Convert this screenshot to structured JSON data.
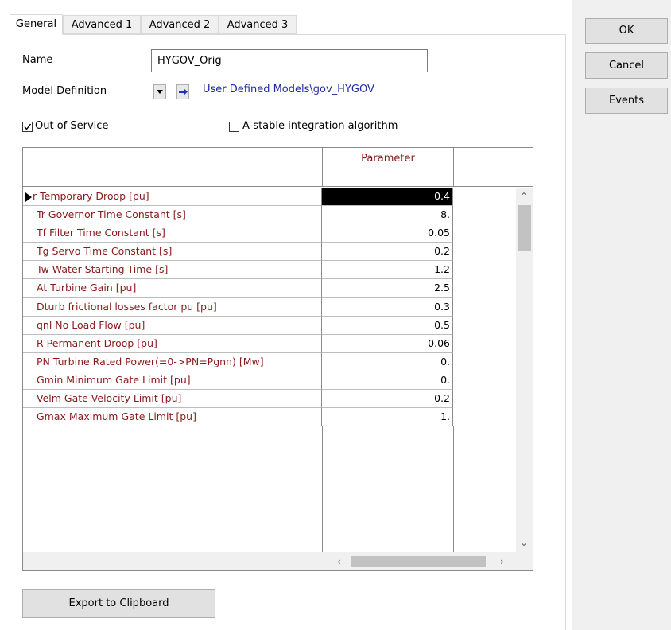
{
  "tabs": [
    "General",
    "Advanced 1",
    "Advanced 2",
    "Advanced 3"
  ],
  "active_tab": "General",
  "side_buttons": {
    "ok": "OK",
    "cancel": "Cancel",
    "events": "Events"
  },
  "name": {
    "label": "Name",
    "value": "HYGOV_Orig"
  },
  "model_definition": {
    "label": "Model Definition",
    "path": "User Defined Models\\gov_HYGOV"
  },
  "checkboxes": {
    "out_of_service": {
      "label": "Out of Service",
      "checked": true
    },
    "astable": {
      "label": "A-stable integration algorithm",
      "checked": false
    }
  },
  "grid": {
    "column_header": "Parameter",
    "rows": [
      {
        "name": "r    Temporary Droop [pu]",
        "value": "0.4"
      },
      {
        "name": "Tr   Governor Time Constant [s]",
        "value": "8."
      },
      {
        "name": "Tf   Filter Time Constant [s]",
        "value": "0.05"
      },
      {
        "name": "Tg   Servo Time Constant [s]",
        "value": "0.2"
      },
      {
        "name": "Tw   Water Starting Time [s]",
        "value": "1.2"
      },
      {
        "name": "At   Turbine Gain [pu]",
        "value": "2.5"
      },
      {
        "name": "Dturb frictional losses factor pu [pu]",
        "value": "0.3"
      },
      {
        "name": "qnl  No Load Flow [pu]",
        "value": "0.5"
      },
      {
        "name": "R    Permanent Droop [pu]",
        "value": "0.06"
      },
      {
        "name": "PN   Turbine Rated Power(=0->PN=Pgnn) [Mw]",
        "value": "0."
      },
      {
        "name": "Gmin  Minimum Gate Limit [pu]",
        "value": "0."
      },
      {
        "name": "Velm  Gate Velocity Limit [pu]",
        "value": "0.2"
      },
      {
        "name": "Gmax  Maximum Gate Limit [pu]",
        "value": "1."
      }
    ]
  },
  "export_button": "Export to Clipboard"
}
